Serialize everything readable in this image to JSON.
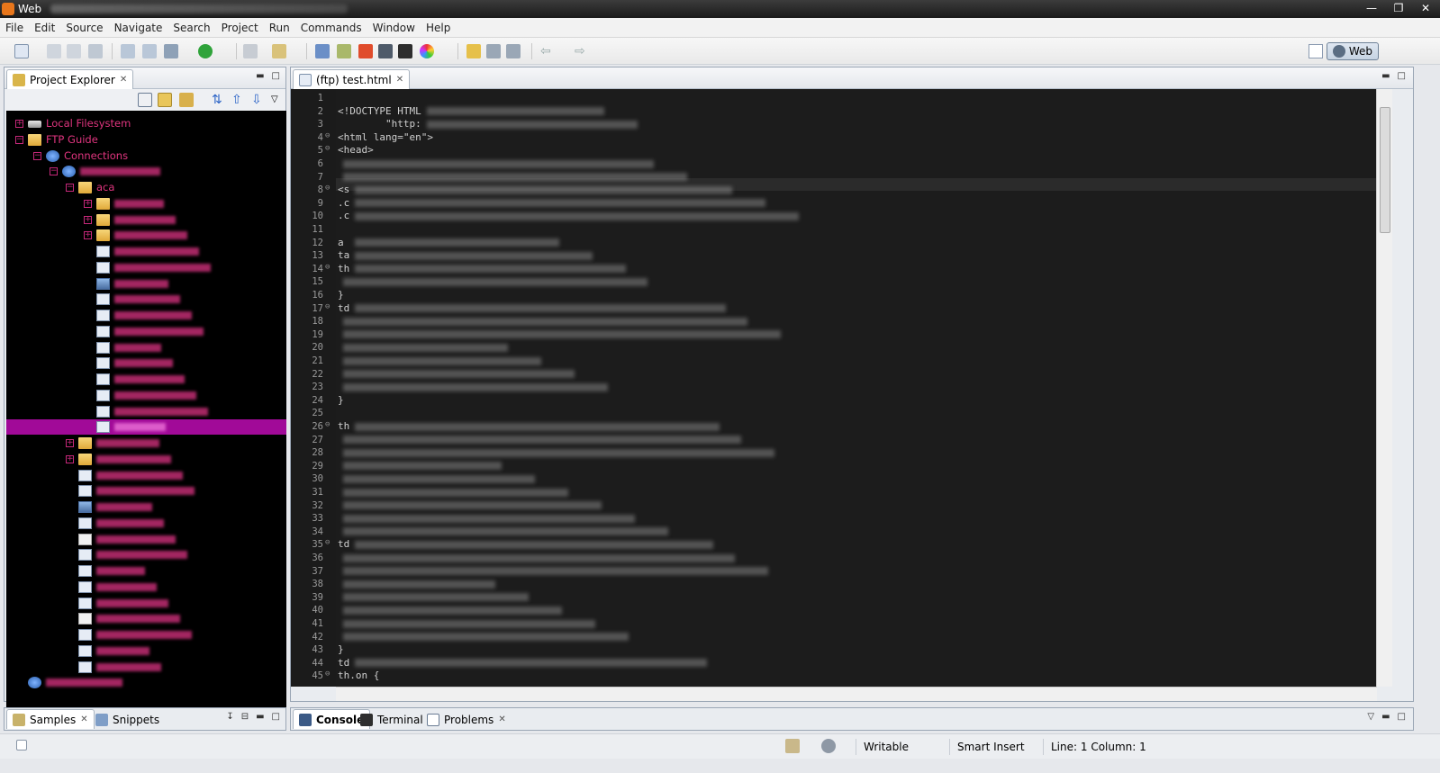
{
  "window": {
    "title": "Web",
    "controls": [
      "minimize",
      "restore",
      "close"
    ]
  },
  "menu": [
    "File",
    "Edit",
    "Source",
    "Navigate",
    "Search",
    "Project",
    "Run",
    "Commands",
    "Window",
    "Help"
  ],
  "perspective": {
    "label": "Web"
  },
  "project_explorer": {
    "tab_label": "Project Explorer",
    "tree": [
      {
        "label": "Local Filesystem",
        "type": "drive",
        "level": 0,
        "expander": "+"
      },
      {
        "label": "FTP Guide",
        "type": "folder",
        "level": 0,
        "expander": "-"
      },
      {
        "label": "Connections",
        "type": "globe",
        "level": 1,
        "expander": "-"
      },
      {
        "label": "",
        "type": "globe",
        "level": 2,
        "expander": "-"
      },
      {
        "label": "aca",
        "type": "folder",
        "level": 3,
        "expander": "-"
      },
      {
        "label": "",
        "type": "folder",
        "level": 4,
        "expander": "+"
      },
      {
        "label": "",
        "type": "folder",
        "level": 4,
        "expander": "+"
      },
      {
        "label": "",
        "type": "folder",
        "level": 4,
        "expander": "+"
      },
      {
        "label": "",
        "type": "file",
        "level": 4
      },
      {
        "label": "",
        "type": "file",
        "level": 4
      },
      {
        "label": "",
        "type": "image",
        "level": 4
      },
      {
        "label": "",
        "type": "file",
        "level": 4
      },
      {
        "label": "",
        "type": "file",
        "level": 4
      },
      {
        "label": "",
        "type": "file",
        "level": 4
      },
      {
        "label": "",
        "type": "file",
        "level": 4
      },
      {
        "label": "",
        "type": "file",
        "level": 4
      },
      {
        "label": "",
        "type": "file",
        "level": 4
      },
      {
        "label": "",
        "type": "file",
        "level": 4
      },
      {
        "label": "",
        "type": "file",
        "level": 4
      },
      {
        "label": "",
        "type": "file",
        "level": 4,
        "selected": true
      },
      {
        "label": "",
        "type": "folder",
        "level": 3,
        "expander": "+"
      },
      {
        "label": "",
        "type": "folder",
        "level": 3,
        "expander": "+"
      },
      {
        "label": "",
        "type": "file",
        "level": 3
      },
      {
        "label": "",
        "type": "file",
        "level": 3
      },
      {
        "label": "",
        "type": "image",
        "level": 3
      },
      {
        "label": "",
        "type": "file",
        "level": 3
      },
      {
        "label": "",
        "type": "js",
        "level": 3
      },
      {
        "label": "",
        "type": "file",
        "level": 3
      },
      {
        "label": "",
        "type": "file",
        "level": 3
      },
      {
        "label": "",
        "type": "file",
        "level": 3
      },
      {
        "label": "",
        "type": "file",
        "level": 3
      },
      {
        "label": "",
        "type": "js",
        "level": 3
      },
      {
        "label": "",
        "type": "file",
        "level": 3
      },
      {
        "label": "",
        "type": "file",
        "level": 3
      },
      {
        "label": "",
        "type": "file",
        "level": 3
      },
      {
        "label": "",
        "type": "globe",
        "level": 0
      }
    ]
  },
  "editor": {
    "tab_label": "(ftp) test.html",
    "lines": [
      {
        "n": "1",
        "text": ""
      },
      {
        "n": "2",
        "text": "<!DOCTYPE HTML",
        "blur": ""
      },
      {
        "n": "3",
        "text": "        \"http:",
        "blur": ""
      },
      {
        "n": "4",
        "text": "<html lang=\"en\">",
        "fold": true
      },
      {
        "n": "5",
        "text": "<head>",
        "fold": true
      },
      {
        "n": "6",
        "text": "",
        "blur": ""
      },
      {
        "n": "7",
        "text": "",
        "blur": ""
      },
      {
        "n": "8",
        "text": "<s",
        "blur": "",
        "fold": true
      },
      {
        "n": "9",
        "text": ".c",
        "blur": ""
      },
      {
        "n": "10",
        "text": ".c",
        "blur": ""
      },
      {
        "n": "11",
        "text": ""
      },
      {
        "n": "12",
        "text": "a ",
        "blur": ""
      },
      {
        "n": "13",
        "text": "ta",
        "blur": ""
      },
      {
        "n": "14",
        "text": "th",
        "blur": "",
        "fold": true
      },
      {
        "n": "15",
        "text": "",
        "blur": ""
      },
      {
        "n": "16",
        "text": "}"
      },
      {
        "n": "17",
        "text": "td",
        "blur": "",
        "fold": true
      },
      {
        "n": "18",
        "text": "",
        "blur": ""
      },
      {
        "n": "19",
        "text": "",
        "blur": ""
      },
      {
        "n": "20",
        "text": "",
        "blur": ""
      },
      {
        "n": "21",
        "text": "",
        "blur": ""
      },
      {
        "n": "22",
        "text": "",
        "blur": ""
      },
      {
        "n": "23",
        "text": "",
        "blur": ""
      },
      {
        "n": "24",
        "text": "}"
      },
      {
        "n": "25",
        "text": ""
      },
      {
        "n": "26",
        "text": "th",
        "blur": "",
        "fold": true
      },
      {
        "n": "27",
        "text": "",
        "blur": ""
      },
      {
        "n": "28",
        "text": "",
        "blur": ""
      },
      {
        "n": "29",
        "text": "",
        "blur": ""
      },
      {
        "n": "30",
        "text": "",
        "blur": ""
      },
      {
        "n": "31",
        "text": "",
        "blur": ""
      },
      {
        "n": "32",
        "text": "",
        "blur": ""
      },
      {
        "n": "33",
        "text": "",
        "blur": ""
      },
      {
        "n": "34",
        "text": "",
        "blur": ""
      },
      {
        "n": "35",
        "text": "td",
        "blur": "",
        "fold": true
      },
      {
        "n": "36",
        "text": "",
        "blur": ""
      },
      {
        "n": "37",
        "text": "",
        "blur": ""
      },
      {
        "n": "38",
        "text": "",
        "blur": ""
      },
      {
        "n": "39",
        "text": "",
        "blur": ""
      },
      {
        "n": "40",
        "text": "",
        "blur": ""
      },
      {
        "n": "41",
        "text": "",
        "blur": ""
      },
      {
        "n": "42",
        "text": "",
        "blur": ""
      },
      {
        "n": "43",
        "text": "}"
      },
      {
        "n": "44",
        "text": "td",
        "blur": ""
      },
      {
        "n": "45",
        "text": "th.on {",
        "fold": true
      }
    ]
  },
  "bottom_left_tabs": [
    "Samples",
    "Snippets"
  ],
  "bottom_tabs": [
    "Console",
    "Terminal",
    "Problems"
  ],
  "status": {
    "writable": "Writable",
    "insert_mode": "Smart Insert",
    "position": "Line: 1 Column: 1"
  },
  "colors": {
    "tree_text": "#e0357f",
    "selection": "#a10a98",
    "editor_bg": "#1c1c1c"
  }
}
